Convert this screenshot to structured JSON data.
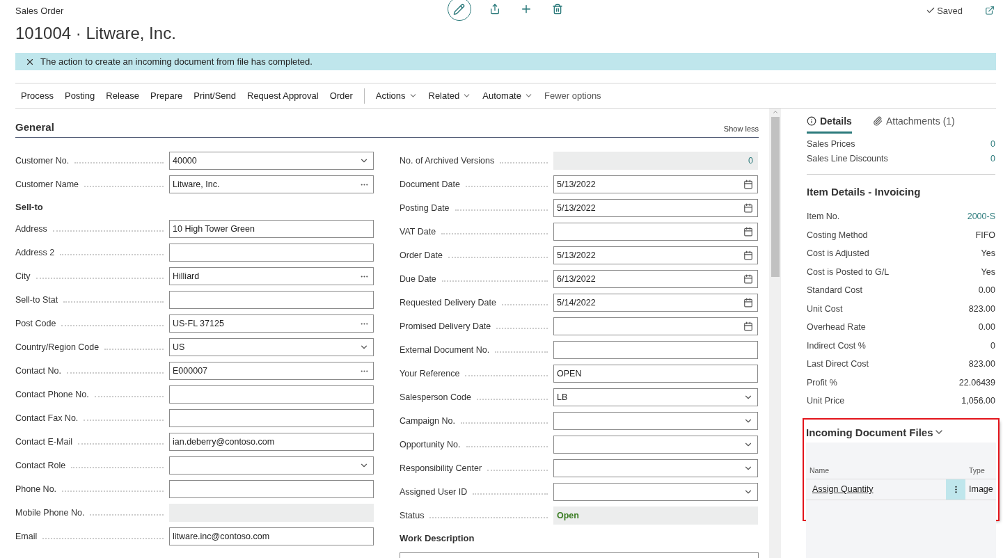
{
  "header": {
    "page_type": "Sales Order",
    "title": "101004 · Litware, Inc.",
    "saved": "Saved"
  },
  "notification": {
    "text": "The action to create an incoming document from file has completed."
  },
  "action_bar": {
    "menus": [
      "Process",
      "Posting",
      "Release",
      "Prepare",
      "Print/Send",
      "Request Approval",
      "Order"
    ],
    "dropdowns": [
      "Actions",
      "Related",
      "Automate"
    ],
    "toggle": "Fewer options"
  },
  "general": {
    "title": "General",
    "show_less": "Show less",
    "left": [
      {
        "kind": "dropdown",
        "label": "Customer No.",
        "value": "40000"
      },
      {
        "kind": "lookup",
        "label": "Customer Name",
        "value": "Litware, Inc."
      },
      {
        "kind": "group",
        "label": "Sell-to"
      },
      {
        "kind": "text",
        "label": "Address",
        "value": "10 High Tower Green"
      },
      {
        "kind": "text",
        "label": "Address 2"
      },
      {
        "kind": "lookup",
        "label": "City",
        "value": "Hilliard"
      },
      {
        "kind": "text",
        "label": "Sell-to Stat"
      },
      {
        "kind": "lookup",
        "label": "Post Code",
        "value": "US-FL 37125"
      },
      {
        "kind": "dropdown",
        "label": "Country/Region Code",
        "value": "US"
      },
      {
        "kind": "lookup",
        "label": "Contact No.",
        "value": "E000007"
      },
      {
        "kind": "text",
        "label": "Contact Phone No."
      },
      {
        "kind": "text",
        "label": "Contact Fax No."
      },
      {
        "kind": "text",
        "label": "Contact E-Mail",
        "value": "ian.deberry@contoso.com"
      },
      {
        "kind": "dropdown",
        "label": "Contact Role"
      },
      {
        "kind": "text",
        "label": "Phone No."
      },
      {
        "kind": "readonly",
        "label": "Mobile Phone No."
      },
      {
        "kind": "text",
        "label": "Email",
        "value": "litware.inc@contoso.com"
      }
    ],
    "right": [
      {
        "kind": "number",
        "label": "No. of Archived Versions",
        "value": "0"
      },
      {
        "kind": "date",
        "label": "Document Date",
        "value": "5/13/2022"
      },
      {
        "kind": "date",
        "label": "Posting Date",
        "value": "5/13/2022"
      },
      {
        "kind": "date",
        "label": "VAT Date"
      },
      {
        "kind": "date",
        "label": "Order Date",
        "value": "5/13/2022"
      },
      {
        "kind": "date",
        "label": "Due Date",
        "value": "6/13/2022"
      },
      {
        "kind": "date",
        "label": "Requested Delivery Date",
        "value": "5/14/2022"
      },
      {
        "kind": "date",
        "label": "Promised Delivery Date"
      },
      {
        "kind": "text",
        "label": "External Document No."
      },
      {
        "kind": "text",
        "label": "Your Reference",
        "value": "OPEN"
      },
      {
        "kind": "dropdown",
        "label": "Salesperson Code",
        "value": "LB"
      },
      {
        "kind": "dropdown",
        "label": "Campaign No."
      },
      {
        "kind": "dropdown",
        "label": "Opportunity No."
      },
      {
        "kind": "dropdown",
        "label": "Responsibility Center"
      },
      {
        "kind": "dropdown",
        "label": "Assigned User ID"
      },
      {
        "kind": "status",
        "label": "Status",
        "value": "Open"
      },
      {
        "kind": "textarea",
        "label": "Work Description"
      }
    ]
  },
  "factbox": {
    "tabs": [
      {
        "label": "Details",
        "selected": true
      },
      {
        "label": "Attachments (1)",
        "selected": false
      }
    ],
    "counts": [
      {
        "label": "Sales Prices",
        "value": "0"
      },
      {
        "label": "Sales Line Discounts",
        "value": "0"
      }
    ],
    "item_details": {
      "title": "Item Details - Invoicing",
      "rows": [
        {
          "label": "Item No.",
          "value": "2000-S",
          "link": true
        },
        {
          "label": "Costing Method",
          "value": "FIFO",
          "link": false
        },
        {
          "label": "Cost is Adjusted",
          "value": "Yes",
          "link": false
        },
        {
          "label": "Cost is Posted to G/L",
          "value": "Yes",
          "link": false
        },
        {
          "label": "Standard Cost",
          "value": "0.00",
          "link": false
        },
        {
          "label": "Unit Cost",
          "value": "823.00",
          "link": false
        },
        {
          "label": "Overhead Rate",
          "value": "0.00",
          "link": false
        },
        {
          "label": "Indirect Cost %",
          "value": "0",
          "link": false
        },
        {
          "label": "Last Direct Cost",
          "value": "823.00",
          "link": false
        },
        {
          "label": "Profit %",
          "value": "22.06439",
          "link": false
        },
        {
          "label": "Unit Price",
          "value": "1,056.00",
          "link": false
        }
      ]
    },
    "incoming_files": {
      "title": "Incoming Document Files",
      "highlighted": true,
      "columns": [
        "Name",
        "Type"
      ],
      "rows": [
        {
          "name": "Assign Quantity",
          "type": "Image"
        }
      ]
    }
  }
}
